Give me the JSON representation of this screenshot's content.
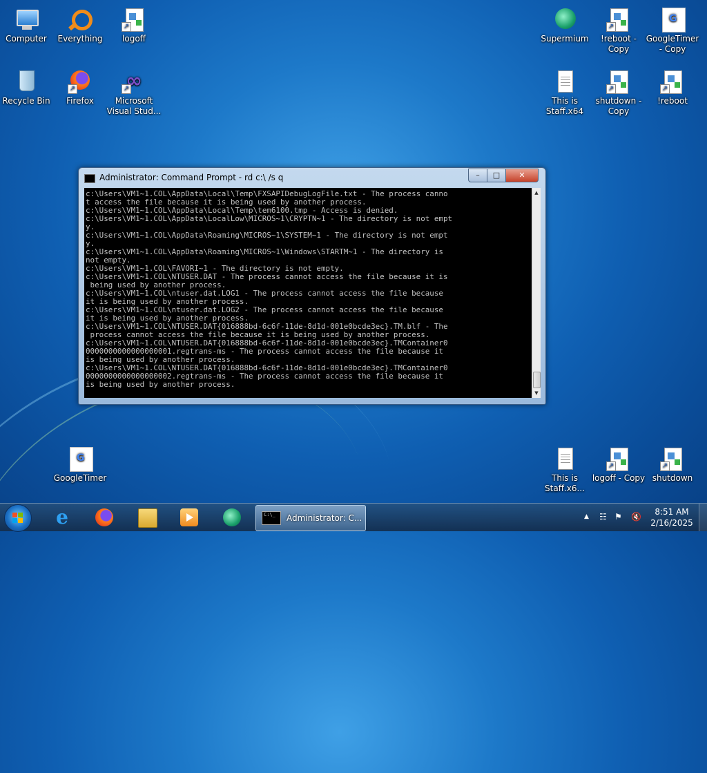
{
  "desktop": {
    "icons": [
      {
        "label": "Computer",
        "icon": "computer-icon"
      },
      {
        "label": "Everything",
        "icon": "everything-icon"
      },
      {
        "label": "logoff",
        "icon": "shortcut-icon"
      },
      {
        "label": "Recycle Bin",
        "icon": "recycle-bin-icon"
      },
      {
        "label": "Firefox",
        "icon": "firefox-icon"
      },
      {
        "label": "Microsoft Visual Stud...",
        "icon": "visual-studio-icon"
      },
      {
        "label": "Supermium",
        "icon": "supermium-icon"
      },
      {
        "label": "!reboot - Copy",
        "icon": "shortcut-icon"
      },
      {
        "label": "GoogleTimer - Copy",
        "icon": "googletimer-icon"
      },
      {
        "label": "This is Staff.x64",
        "icon": "text-file-icon"
      },
      {
        "label": "shutdown - Copy",
        "icon": "shortcut-icon"
      },
      {
        "label": "!reboot",
        "icon": "shortcut-icon"
      },
      {
        "label": "GoogleTimer",
        "icon": "googletimer-icon"
      },
      {
        "label": "This is Staff.x6...",
        "icon": "text-file-icon"
      },
      {
        "label": "logoff - Copy",
        "icon": "shortcut-icon"
      },
      {
        "label": "shutdown",
        "icon": "shortcut-icon"
      }
    ]
  },
  "console_window": {
    "title": "Administrator:  Command Prompt - rd  c:\\ /s q",
    "controls": {
      "minimize": "–",
      "maximize": "□",
      "close": "✕"
    },
    "output": "c:\\Users\\VM1~1.COL\\AppData\\Local\\Temp\\FXSAPIDebugLogFile.txt - The process canno\nt access the file because it is being used by another process.\nc:\\Users\\VM1~1.COL\\AppData\\Local\\Temp\\tem6100.tmp - Access is denied.\nc:\\Users\\VM1~1.COL\\AppData\\LocalLow\\MICROS~1\\CRYPTN~1 - The directory is not empt\ny.\nc:\\Users\\VM1~1.COL\\AppData\\Roaming\\MICROS~1\\SYSTEM~1 - The directory is not empt\ny.\nc:\\Users\\VM1~1.COL\\AppData\\Roaming\\MICROS~1\\Windows\\STARTM~1 - The directory is\nnot empty.\nc:\\Users\\VM1~1.COL\\FAVORI~1 - The directory is not empty.\nc:\\Users\\VM1~1.COL\\NTUSER.DAT - The process cannot access the file because it is\n being used by another process.\nc:\\Users\\VM1~1.COL\\ntuser.dat.LOG1 - The process cannot access the file because\nit is being used by another process.\nc:\\Users\\VM1~1.COL\\ntuser.dat.LOG2 - The process cannot access the file because\nit is being used by another process.\nc:\\Users\\VM1~1.COL\\NTUSER.DAT{016888bd-6c6f-11de-8d1d-001e0bcde3ec}.TM.blf - The\n process cannot access the file because it is being used by another process.\nc:\\Users\\VM1~1.COL\\NTUSER.DAT{016888bd-6c6f-11de-8d1d-001e0bcde3ec}.TMContainer0\n0000000000000000001.regtrans-ms - The process cannot access the file because it\nis being used by another process.\nc:\\Users\\VM1~1.COL\\NTUSER.DAT{016888bd-6c6f-11de-8d1d-001e0bcde3ec}.TMContainer0\n0000000000000000002.regtrans-ms - The process cannot access the file because it\nis being used by another process."
  },
  "taskbar": {
    "pinned": [
      "start-orb-icon",
      "internet-explorer-icon",
      "firefox-icon",
      "file-explorer-icon",
      "media-player-icon",
      "supermium-icon"
    ],
    "active_task": {
      "label": "Administrator:  C...",
      "icon": "command-prompt-icon"
    },
    "tray": {
      "arrow": "▲",
      "network": "network-icon",
      "flag": "action-center-flag-icon",
      "volume": "volume-muted-icon"
    },
    "clock": {
      "time": "8:51 AM",
      "date": "2/16/2025"
    }
  },
  "colors": {
    "console_bg": "#000000",
    "console_fg": "#c0c0c0",
    "desktop_blue": "#1d79c9"
  }
}
